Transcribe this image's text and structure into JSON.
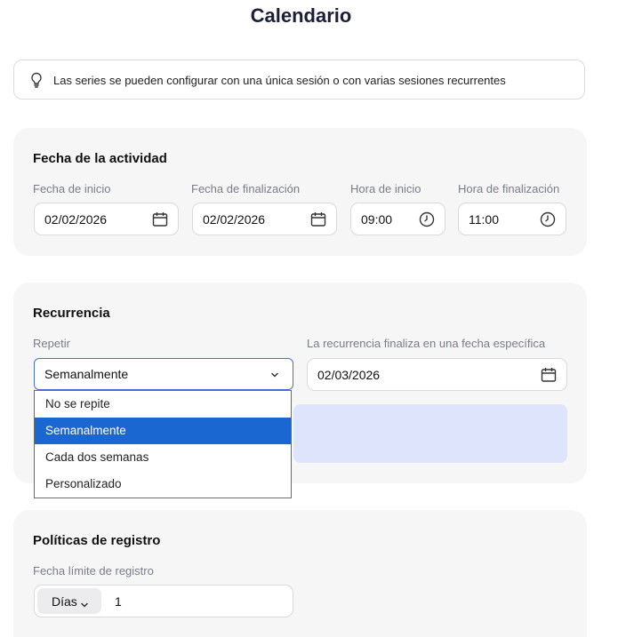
{
  "page": {
    "title": "Calendario"
  },
  "info": {
    "text": "Las series se pueden configurar con una única sesión o con varias sesiones recurrentes",
    "icon": "lightbulb-icon"
  },
  "activity": {
    "heading": "Fecha de la actividad",
    "start_date_label": "Fecha de inicio",
    "start_date": "02/02/2026",
    "end_date_label": "Fecha de finalización",
    "end_date": "02/02/2026",
    "start_time_label": "Hora de inicio",
    "start_time": "09:00",
    "end_time_label": "Hora de finalización",
    "end_time": "11:00"
  },
  "recurrence": {
    "heading": "Recurrencia",
    "repeat_label": "Repetir",
    "repeat_value": "Semanalmente",
    "end_label": "La recurrencia finaliza en una fecha específica",
    "end_date": "02/03/2026",
    "options": [
      "No se repite",
      "Semanalmente",
      "Cada dos semanas",
      "Personalizado"
    ],
    "selected_option": "Semanalmente"
  },
  "registration": {
    "heading": "Políticas de registro",
    "deadline_label": "Fecha límite de registro",
    "unit": "Días",
    "amount": "1"
  },
  "colors": {
    "accent": "#1a67d2",
    "card_bg": "#f6f6f7",
    "info_box": "#dde4fb"
  }
}
